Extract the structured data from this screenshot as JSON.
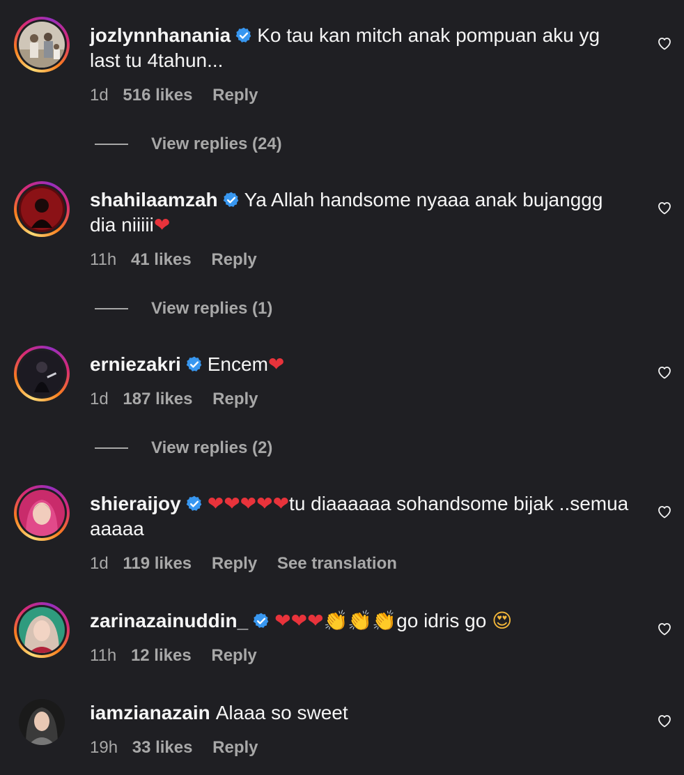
{
  "comments": [
    {
      "username": "jozlynnhanania",
      "verified": true,
      "text": "Ko tau kan mitch anak pompuan aku yg last tu 4tahun...",
      "time": "1d",
      "likes": "516 likes",
      "reply": "Reply",
      "view_replies": "View replies (24)"
    },
    {
      "username": "shahilaamzah",
      "verified": true,
      "text": "Ya Allah handsome nyaaa anak bujanggg dia niiiii",
      "emoji": "❤",
      "time": "11h",
      "likes": "41 likes",
      "reply": "Reply",
      "view_replies": "View replies (1)"
    },
    {
      "username": "erniezakri",
      "verified": true,
      "text": "Encem",
      "emoji": "❤",
      "time": "1d",
      "likes": "187 likes",
      "reply": "Reply",
      "view_replies": "View replies (2)"
    },
    {
      "username": "shieraijoy",
      "verified": true,
      "emoji_prefix": "❤❤❤❤❤",
      "text": "tu diaaaaaa sohandsome bijak ..semua aaaaa",
      "time": "1d",
      "likes": "119 likes",
      "reply": "Reply",
      "see_translation": "See translation"
    },
    {
      "username": "zarinazainuddin_",
      "verified": true,
      "emoji_prefix": "❤❤❤",
      "emoji_clap": "👏👏👏",
      "text": "go idris go",
      "emoji": "😍",
      "time": "11h",
      "likes": "12 likes",
      "reply": "Reply"
    },
    {
      "username": "iamzianazain",
      "verified": false,
      "text": "Alaaa so sweet",
      "time": "19h",
      "likes": "33 likes",
      "reply": "Reply"
    }
  ],
  "colors": {
    "background": "#1f1f23",
    "text": "#f5f5f5",
    "muted": "#a8a8a8",
    "verified": "#3897f0",
    "heart_emoji": "#e8333b"
  },
  "icons": {
    "like": "heart-outline-icon",
    "verified": "verified-badge-icon"
  }
}
